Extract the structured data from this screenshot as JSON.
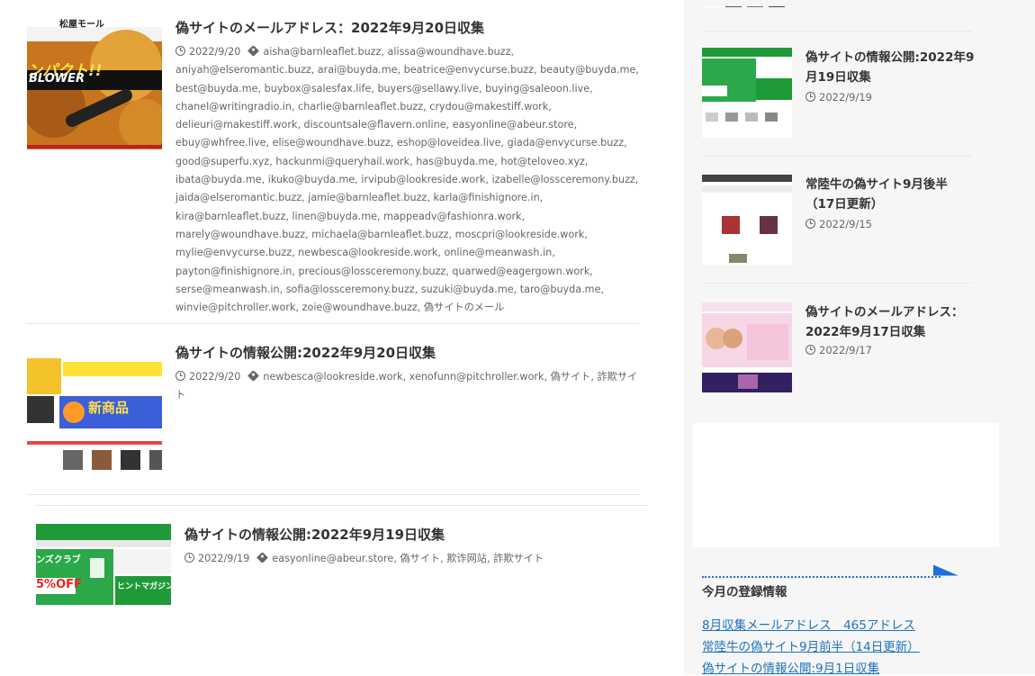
{
  "posts": [
    {
      "title": "偽サイトのメールアドレス：2022年9月20日収集",
      "date": "2022/9/20",
      "tags": "aisha@barnleaflet.buzz, alissa@woundhave.buzz, aniyah@elseromantic.buzz, arai@buyda.me, beatrice@envycurse.buzz, beauty@buyda.me, best@buyda.me, buybox@salesfax.life, buyers@sellawy.live, buying@saleoon.live, chanel@writingradio.in, charlie@barnleaflet.buzz, crydou@makestiff.work, delieuri@makestiff.work, discountsale@flavern.online, easyonline@abeur.store, ebuy@whfree.live, elise@woundhave.buzz, eshop@loveidea.live, giada@envycurse.buzz, good@superfu.xyz, hackunmi@queryhail.work, has@buyda.me, hot@teloveo.xyz, ibata@buyda.me, ikuko@buyda.me, irvipub@lookreside.work, izabelle@lossceremony.buzz, jaida@elseromantic.buzz, jamie@barnleaflet.buzz, karla@finishignore.in, kira@barnleaflet.buzz, linen@buyda.me, mappeadv@fashionra.work, marely@woundhave.buzz, michaela@barnleaflet.buzz, moscpri@lookreside.work, mylie@envycurse.buzz, newbesca@lookreside.work, online@meanwash.in, payton@finishignore.in, precious@lossceremony.buzz, quarwed@eagergown.work, serse@meanwash.in, sofia@lossceremony.buzz, suzuki@buyda.me, taro@buyda.me, winvie@pitchroller.work, zoie@woundhave.buzz, 偽サイトのメール",
      "thumb_text_1": "松屋モール",
      "thumb_text_2": "ンパクト!!",
      "thumb_text_3": "BLOWER"
    },
    {
      "title": "偽サイトの情報公開:2022年9月20日収集",
      "date": "2022/9/20",
      "tags": "newbesca@lookreside.work, xenofunn@pitchroller.work, 偽サイト, 詐欺サイト",
      "thumb_text_1": "新商品"
    },
    {
      "title": "偽サイトの情報公開:2022年9月19日収集",
      "date": "2022/9/19",
      "tags": "easyonline@abeur.store, 偽サイト, 欺诈网站, 詐欺サイト",
      "thumb_text_1": "ンズクラブ",
      "thumb_text_2": "5%OFF",
      "thumb_text_3": "ヒントマガジン"
    }
  ],
  "sidebar": {
    "items": [
      {
        "title": "偽サイトの情報公開:2022年9月19日収集",
        "date": "2022/9/19"
      },
      {
        "title": "常陸牛の偽サイト9月後半（17日更新）",
        "date": "2022/9/15"
      },
      {
        "title": "偽サイトのメールアドレス：2022年9月17日収集",
        "date": "2022/9/17"
      }
    ],
    "month_heading": "今月の登録情報",
    "month_links": [
      "8月収集メールアドレス　465アドレス",
      "常陸牛の偽サイト9月前半（14日更新）",
      "偽サイトの情報公開:9月1日収集"
    ]
  },
  "colors": {
    "link": "#1e73be",
    "accent_blue": "#1e6fd9",
    "green_site": "#1f9a38"
  },
  "icons": [
    "clock-icon",
    "tag-icon",
    "arrow-icon"
  ]
}
